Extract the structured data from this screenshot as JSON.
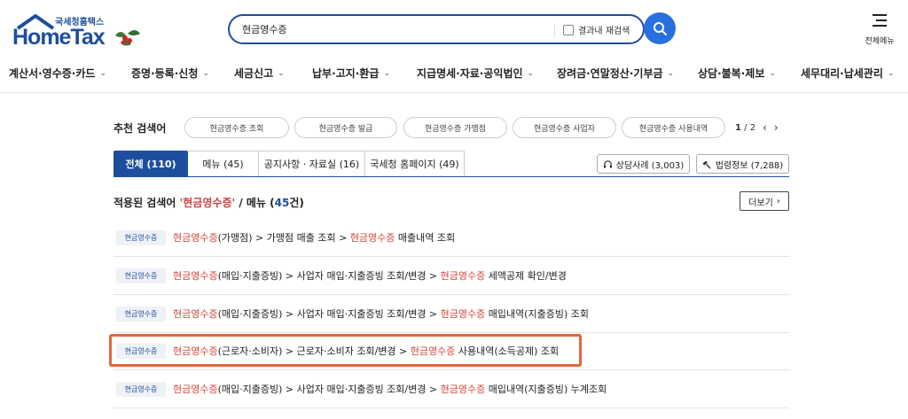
{
  "header": {
    "logo_kr": "국세청홈택스",
    "logo_en": "HomeTax",
    "search_value": "현금영수증",
    "search_within_label": "결과내 재검색",
    "all_menu_label": "전체메뉴"
  },
  "gnb": [
    "계산서·영수증·카드",
    "증명·등록·신청",
    "세금신고",
    "납부·고지·환급",
    "지급명세·자료·공익법인",
    "장려금·연말정산·기부금",
    "상담·불복·제보",
    "세무대리·납세관리"
  ],
  "recommend": {
    "title": "추천 검색어",
    "chips": [
      "현금영수증 조회",
      "현금영수증 발급",
      "현금영수증 가맹점",
      "현금영수증 사업자",
      "현금영수증 사용내역"
    ],
    "page_current": "1",
    "page_sep": " / ",
    "page_total": "2"
  },
  "tabs": [
    "전체 (110)",
    "메뉴 (45)",
    "공지사항 · 자료실 (16)",
    "국세청 홈페이지 (49)"
  ],
  "side_buttons": [
    "상담사례 (3,003)",
    "법령정보 (7,288)"
  ],
  "results": {
    "head_prefix": "적용된 검색어 ",
    "head_keyword": "'현금영수증'",
    "head_middle": " / 메뉴 (",
    "head_count": "45",
    "head_suffix": "건)",
    "more_label": "더보기",
    "badge": "현금영수증",
    "rows": [
      {
        "p1": "현금영수증",
        "p2": "(가맹점) > 가맹점 매출 조회 > ",
        "p3": "현금영수증",
        "p4": " 매출내역 조회"
      },
      {
        "p1": "현금영수증",
        "p2": "(매입·지출증빙) > 사업자 매입·지출증빙 조회/변경 > ",
        "p3": "현금영수증",
        "p4": " 세액공제 확인/변경"
      },
      {
        "p1": "현금영수증",
        "p2": "(매입·지출증빙) > 사업자 매입·지출증빙 조회/변경 > ",
        "p3": "현금영수증",
        "p4": " 매입내역(지출증빙) 조회"
      },
      {
        "p1": "현금영수증",
        "p2": "(근로자·소비자) > 근로자·소비자 조회/변경 > ",
        "p3": "현금영수증",
        "p4": " 사용내역(소득공제) 조회"
      },
      {
        "p1": "현금영수증",
        "p2": "(매입·지출증빙) > 사업자 매입·지출증빙 조회/변경 > ",
        "p3": "현금영수증",
        "p4": " 매입내역(지출증빙) 누계조회"
      }
    ]
  },
  "colors": {
    "brand": "#1d4e9e",
    "keyword": "#d2443a",
    "highlight_box": "#e8643a",
    "search_button": "#2a6fe0"
  },
  "icons": [
    "hometax-roof-icon",
    "holly-icon",
    "search-icon",
    "menu-bars-icon",
    "headset-icon",
    "law-icon",
    "chevron-down-icon",
    "chevron-left-icon",
    "chevron-right-icon"
  ]
}
